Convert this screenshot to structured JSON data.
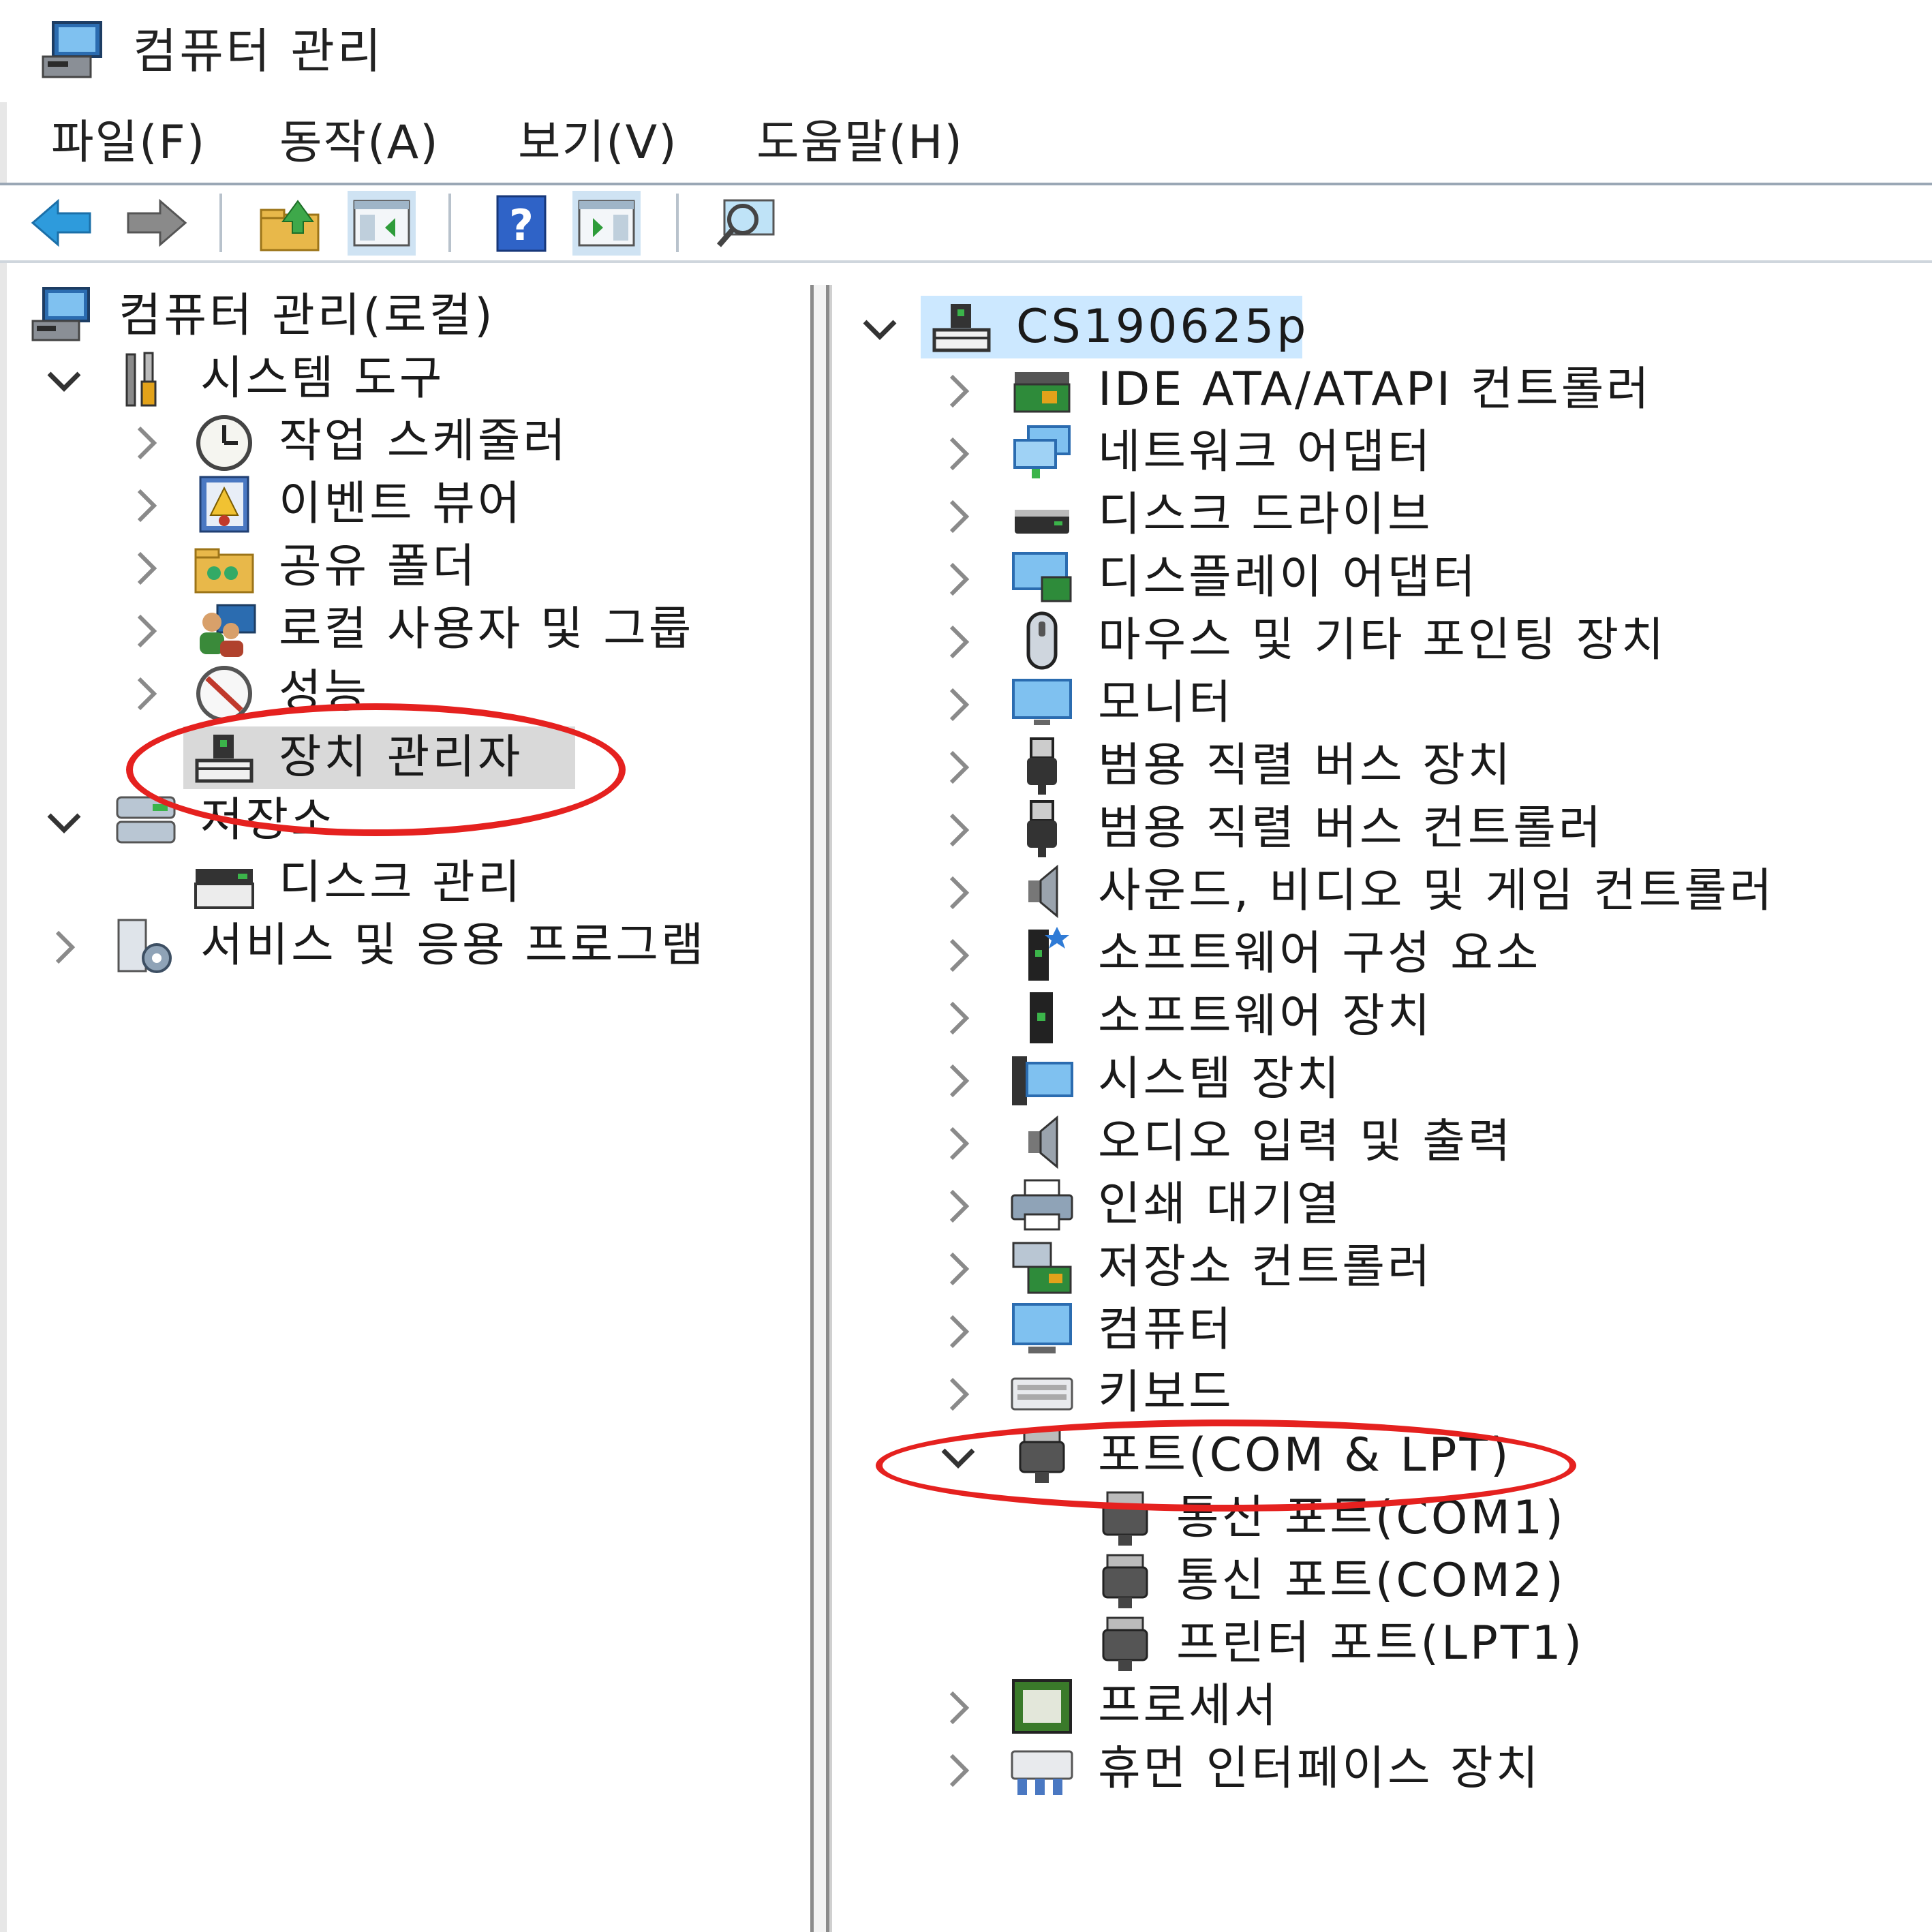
{
  "window": {
    "title": "컴퓨터 관리"
  },
  "menu": [
    "파일(F)",
    "동작(A)",
    "보기(V)",
    "도움말(H)"
  ],
  "toolbar": {
    "buttons": [
      "back-arrow-icon",
      "forward-arrow-icon",
      "up-folder-icon",
      "show-hide-console-tree-icon",
      "help-icon",
      "show-hide-action-pane-icon",
      "scan-hardware-icon"
    ]
  },
  "left_tree": {
    "root": "컴퓨터 관리(로컬)",
    "system_tools": "시스템 도구",
    "task_scheduler": "작업 스케줄러",
    "event_viewer": "이벤트 뷰어",
    "shared_folders": "공유 폴더",
    "local_users": "로컬 사용자 및 그룹",
    "performance": "성능",
    "device_manager": "장치 관리자",
    "storage": "저장소",
    "disk_management": "디스크 관리",
    "services": "서비스 및 응용 프로그램"
  },
  "right_tree": {
    "computer": "CS190625p",
    "categories": [
      "IDE ATA/ATAPI 컨트롤러",
      "네트워크 어댑터",
      "디스크 드라이브",
      "디스플레이 어댑터",
      "마우스 및 기타 포인팅 장치",
      "모니터",
      "범용 직렬 버스 장치",
      "범용 직렬 버스 컨트롤러",
      "사운드, 비디오 및 게임 컨트롤러",
      "소프트웨어 구성 요소",
      "소프트웨어 장치",
      "시스템 장치",
      "오디오 입력 및 출력",
      "인쇄 대기열",
      "저장소 컨트롤러",
      "컴퓨터",
      "키보드",
      "포트(COM & LPT)"
    ],
    "ports": [
      "통신 포트(COM1)",
      "통신 포트(COM2)",
      "프린터 포트(LPT1)"
    ],
    "after_ports": [
      "프로세서",
      "휴먼 인터페이스 장치"
    ]
  },
  "colors": {
    "highlight": "#e5211f",
    "selection": "#d9d9d9",
    "hover": "#cce8ff"
  }
}
